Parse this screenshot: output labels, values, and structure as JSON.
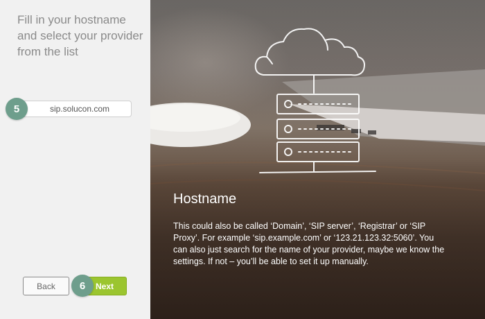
{
  "left_panel": {
    "instruction": "Fill in your hostname and select your provider from the list",
    "hostname_value": "sip.solucon.com",
    "step_input_badge": "5",
    "step_next_badge": "6",
    "back_label": "Back",
    "next_label": "Next"
  },
  "info_panel": {
    "title": "Hostname",
    "description": "This could also be called ‘Domain’, ‘SIP server’, ‘Registrar’ or ‘SIP Proxy’. For example ‘sip.example.com’ or ‘123.21.123.32:5060’. You can also just search for the name of your provider, maybe we know the settings. If not – you’ll be able to set it up manually."
  },
  "colors": {
    "left_background": "#f1f1f1",
    "badge": "#6e9e8c",
    "next_button": "#9bc52f",
    "instruction_text": "#8a8a8a"
  },
  "icons": [
    "cloud-icon",
    "server-rack-icon"
  ]
}
